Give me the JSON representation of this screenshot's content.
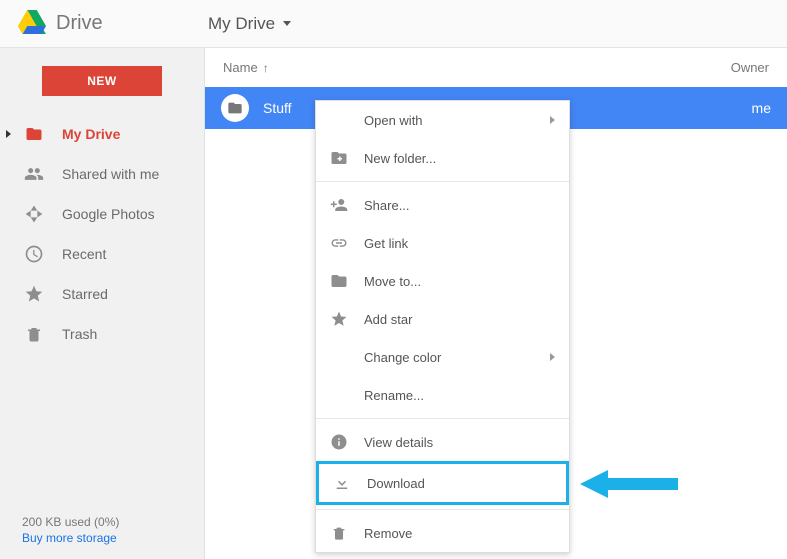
{
  "header": {
    "brand": "Drive",
    "breadcrumb": "My Drive"
  },
  "sidebar": {
    "new_label": "NEW",
    "items": [
      {
        "label": "My Drive"
      },
      {
        "label": "Shared with me"
      },
      {
        "label": "Google Photos"
      },
      {
        "label": "Recent"
      },
      {
        "label": "Starred"
      },
      {
        "label": "Trash"
      }
    ],
    "storage_line": "200 KB used (0%)",
    "storage_link": "Buy more storage"
  },
  "columns": {
    "name": "Name",
    "owner": "Owner"
  },
  "row": {
    "name": "Stuff",
    "owner": "me"
  },
  "menu": {
    "open_with": "Open with",
    "new_folder": "New folder...",
    "share": "Share...",
    "get_link": "Get link",
    "move_to": "Move to...",
    "add_star": "Add star",
    "change_color": "Change color",
    "rename": "Rename...",
    "view_details": "View details",
    "download": "Download",
    "remove": "Remove"
  }
}
